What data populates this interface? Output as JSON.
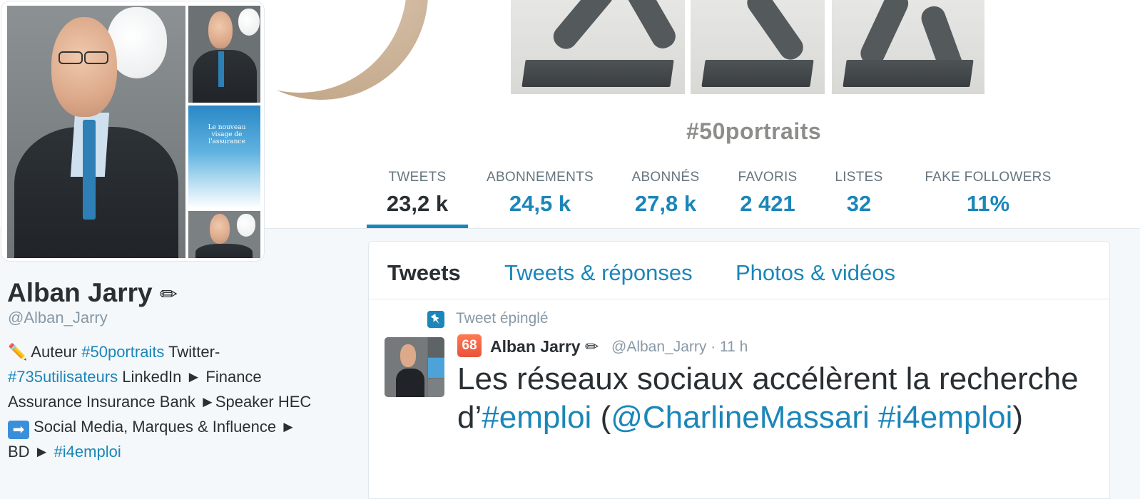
{
  "banner": {
    "hashtag": "#50portraits"
  },
  "stats": [
    {
      "label": "TWEETS",
      "value": "23,2 k"
    },
    {
      "label": "ABONNEMENTS",
      "value": "24,5 k"
    },
    {
      "label": "ABONNÉS",
      "value": "27,8 k"
    },
    {
      "label": "FAVORIS",
      "value": "2 421"
    },
    {
      "label": "LISTES",
      "value": "32"
    },
    {
      "label": "FAKE FOLLOWERS",
      "value": "11%"
    }
  ],
  "profile": {
    "name": "Alban Jarry",
    "name_icon": "✏",
    "handle": "@Alban_Jarry",
    "book_title": "Le nouveau visage de l'assurance",
    "bio": {
      "pencil": "✏️",
      "t1": " Auteur ",
      "tag1": "#50portraits",
      "t2": " Twitter-",
      "tag2": "#735utilisateurs",
      "t3": " LinkedIn ► Finance Assurance Insurance Bank ►Speaker HEC ",
      "arrow": "➡",
      "t4": " Social Media, Marques & Influence ► BD ► ",
      "tag3": "#i4emploi"
    }
  },
  "timeline": {
    "tabs": [
      "Tweets",
      "Tweets & réponses",
      "Photos & vidéos"
    ],
    "pinned_label": "Tweet épinglé",
    "tweet": {
      "badge": "68",
      "author": "Alban Jarry ✏",
      "handle_time": "@Alban_Jarry · 11 h",
      "text_1": "Les réseaux sociaux accélèrent la recherche d’",
      "hashtag_1": "#emploi",
      "text_2": " (",
      "mention": "@CharlineMassari",
      "text_3": " ",
      "hashtag_2": "#i4emploi",
      "text_4": ")"
    }
  },
  "colors": {
    "link": "#1b86b9",
    "text": "#292f33",
    "muted": "#8899a6",
    "background": "#f5f8fa"
  }
}
